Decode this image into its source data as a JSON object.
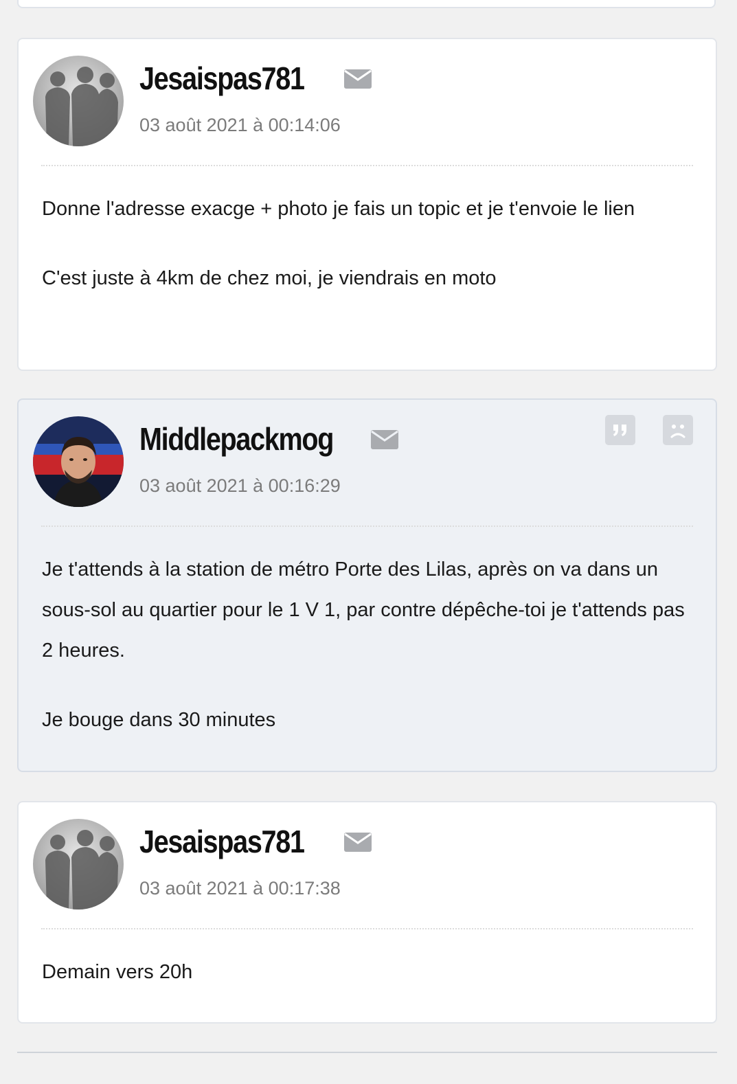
{
  "posts": [
    {
      "author": "Jesaispas781",
      "date": "03 août 2021 à 00:14:06",
      "avatar": "group-silhouette-avatar",
      "paragraphs": [
        "Donne l'adresse exacge + photo je fais un topic et je t'envoie le lien",
        "C'est juste à 4km de chez moi, je viendrais en moto"
      ]
    },
    {
      "author": "Middlepackmog",
      "date": "03 août 2021 à 00:16:29",
      "avatar": "person-photo-avatar",
      "paragraphs": [
        "Je t'attends à la station de métro Porte des Lilas, après on va dans un sous-sol au quartier pour le 1 V 1, par contre dépêche-toi je t'attends pas 2 heures.",
        "Je bouge dans 30 minutes"
      ],
      "actions": [
        "quote-icon",
        "sad-face-icon"
      ]
    },
    {
      "author": "Jesaispas781",
      "date": "03 août 2021 à 00:17:38",
      "avatar": "group-silhouette-avatar",
      "paragraphs": [
        "Demain vers 20h"
      ]
    }
  ],
  "colors": {
    "page_bg": "#f1f1f1",
    "card_bg": "#ffffff",
    "highlight_card_bg": "#eef1f5",
    "username": "#111111",
    "date": "#7b7b7b",
    "icon_gray": "#a9abaf"
  }
}
